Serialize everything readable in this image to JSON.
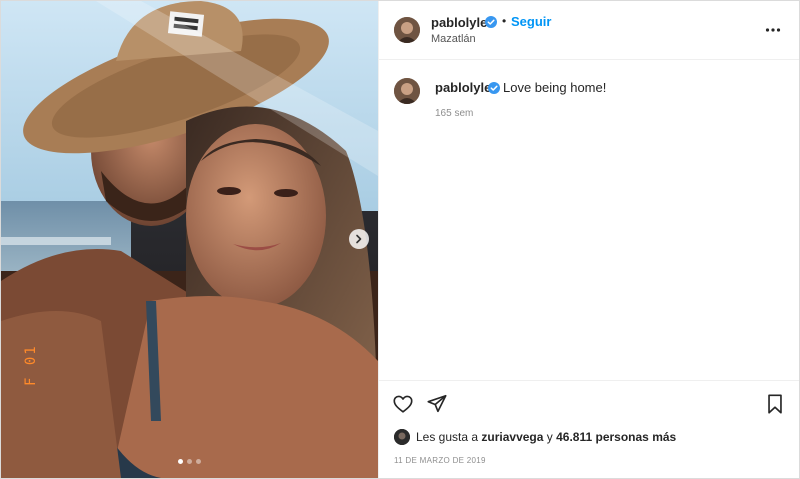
{
  "post": {
    "username": "pablolyle",
    "verified": true,
    "follow_label": "Seguir",
    "bullet": "•",
    "location": "Mazatlán",
    "caption": "Love being home!",
    "time_ago": "165 sem",
    "likes": {
      "prefix": "Les gusta a",
      "liker": "zuriavvega",
      "connector": "y",
      "others": "46.811 personas más"
    },
    "date": "11 DE MARZO DE 2019",
    "carousel": {
      "slide_count": 3,
      "active_index": 0
    },
    "photo_stamp": "F 01"
  },
  "icons": {
    "more": "more-options-icon",
    "next": "chevron-right-icon",
    "like": "heart-icon",
    "share": "paper-plane-icon",
    "save": "bookmark-icon",
    "verified": "verified-badge-icon"
  },
  "colors": {
    "accent": "#0095f6",
    "verified": "#3897f0",
    "text": "#262626",
    "muted": "#8e8e8e"
  }
}
